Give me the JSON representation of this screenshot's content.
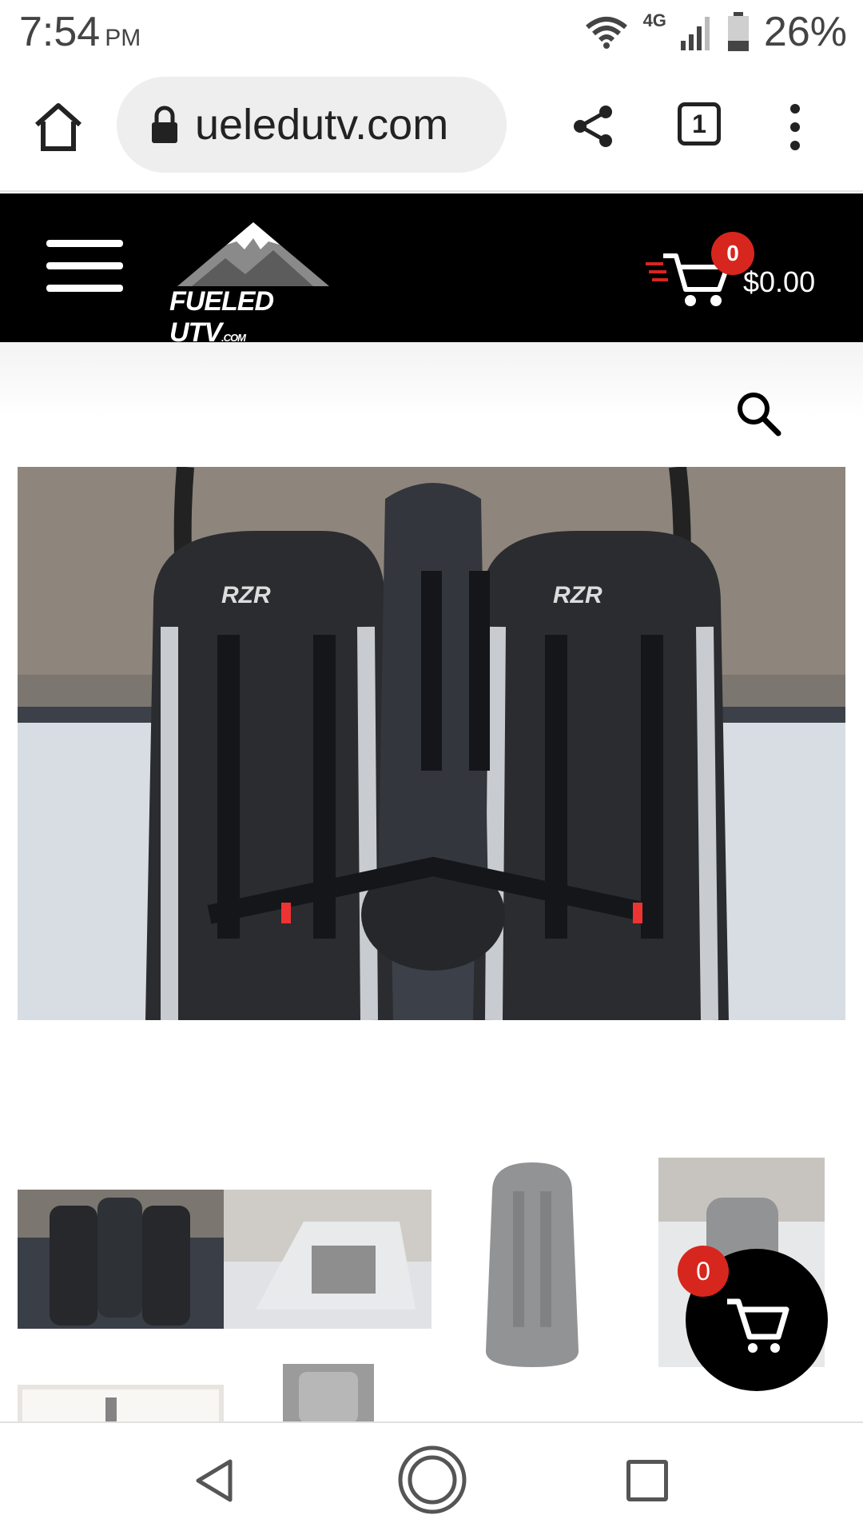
{
  "status_bar": {
    "time": "7:54",
    "ampm": "PM",
    "network": "4G",
    "battery": "26%"
  },
  "browser": {
    "url": "ueledutv.com",
    "tab_count": "1"
  },
  "site_header": {
    "logo_text": "FUELED UTV",
    "logo_suffix": ".COM",
    "cart_count": "0",
    "cart_total": "$0.00"
  },
  "floating_cart": {
    "count": "0"
  },
  "colors": {
    "accent_red": "#d7261e",
    "header_bg": "#000000"
  },
  "icons": [
    "home-icon",
    "lock-icon",
    "share-icon",
    "tabs-icon",
    "overflow-menu-icon",
    "hamburger-menu-icon",
    "cart-icon",
    "search-icon",
    "back-icon",
    "nav-home-icon",
    "recent-apps-icon"
  ]
}
